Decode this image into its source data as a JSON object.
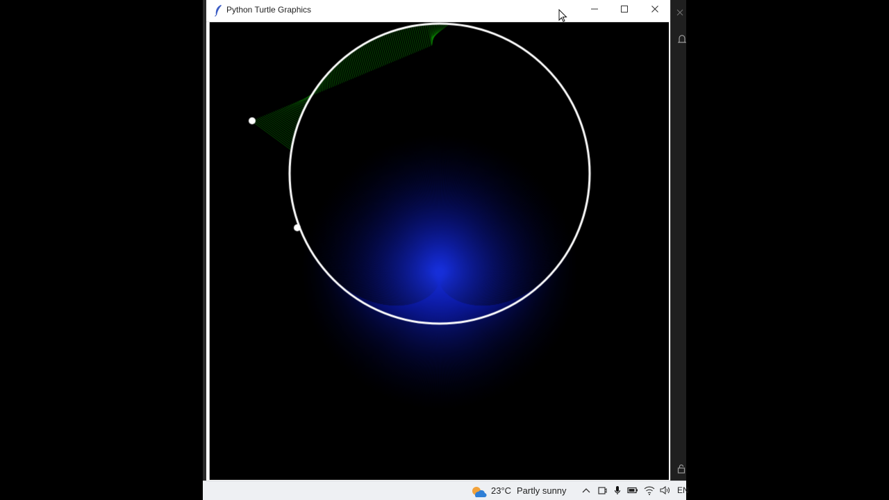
{
  "window": {
    "title": "Python Turtle Graphics",
    "icons": {
      "app": "feather-icon",
      "minimize": "minimize-icon",
      "maximize": "maximize-icon",
      "close": "close-icon",
      "cursor": "mouse-pointer-icon"
    }
  },
  "canvas": {
    "background": "#000000",
    "ray_colors": {
      "main": "#0a1cff",
      "active": "#0b8a00"
    },
    "circle_color": "#ffffff",
    "turtle_color": "#ffffff"
  },
  "right_strip": {
    "icons": [
      "close-icon",
      "bell-icon",
      "lock-icon"
    ]
  },
  "taskbar": {
    "weather_temp": "23°C",
    "weather_desc": "Partly sunny",
    "tray_icons": [
      "chevron-up-icon",
      "meet-now-icon",
      "microphone-icon",
      "battery-icon",
      "wifi-icon",
      "volume-icon"
    ],
    "language": "EN"
  }
}
